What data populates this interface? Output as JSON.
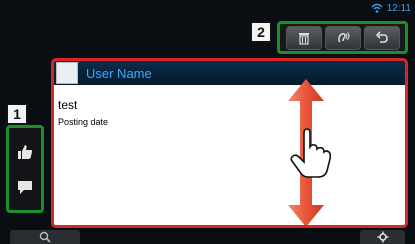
{
  "status": {
    "clock": "12:11"
  },
  "callouts": {
    "side": "1",
    "toolbar": "2"
  },
  "post": {
    "username": "User Name",
    "text": "test",
    "date": "Posting date"
  },
  "toolbar": {
    "icons": [
      "trash-icon",
      "voice-icon",
      "back-icon"
    ]
  },
  "side": {
    "icons": [
      "thumbs-up-icon",
      "comment-icon"
    ]
  },
  "colors": {
    "highlight_red": "#d62626",
    "highlight_green": "#1c8f2a",
    "username_blue": "#3aa8ff",
    "arrow_orange": "#e8553a"
  }
}
